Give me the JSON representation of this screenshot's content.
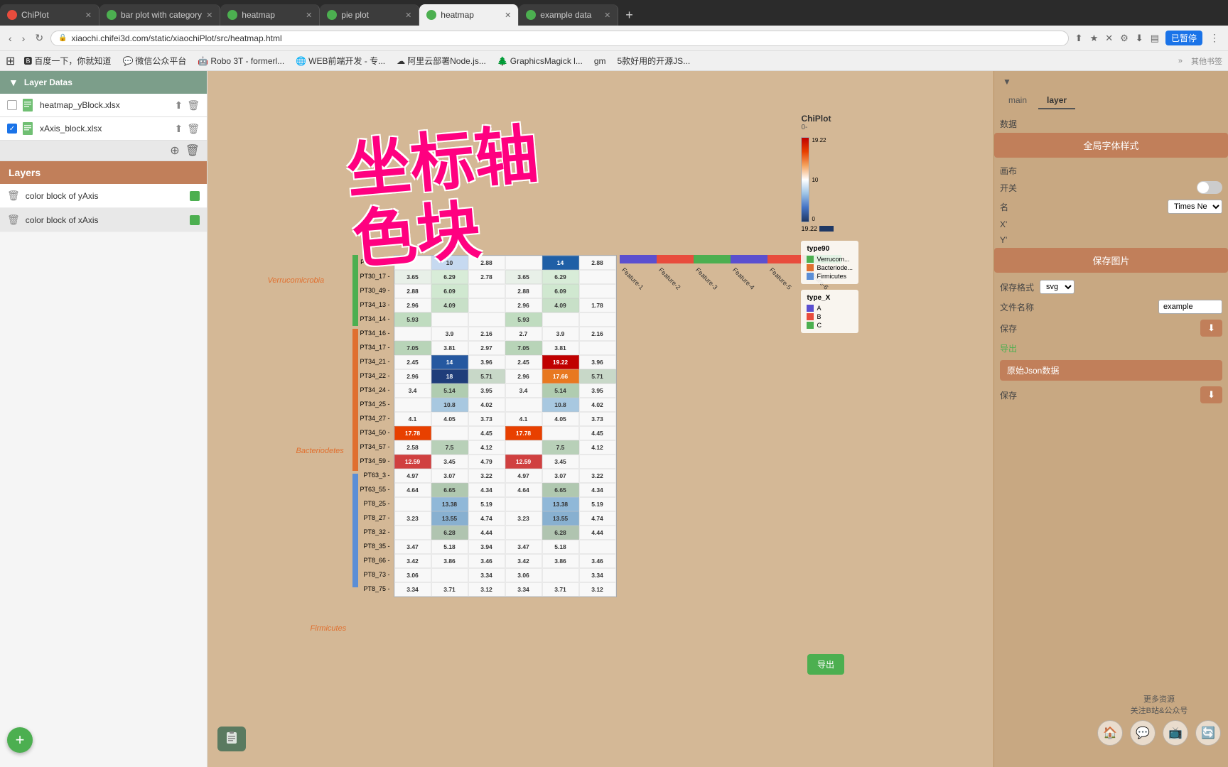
{
  "browser": {
    "tabs": [
      {
        "id": "chiplot",
        "label": "ChiPlot",
        "active": false,
        "icon_color": "#e84c3d"
      },
      {
        "id": "bar-plot",
        "label": "bar plot with category",
        "active": false,
        "icon_color": "#4CAF50"
      },
      {
        "id": "heatmap1",
        "label": "heatmap",
        "active": false,
        "icon_color": "#4CAF50"
      },
      {
        "id": "pie-plot",
        "label": "pie plot",
        "active": false,
        "icon_color": "#4CAF50"
      },
      {
        "id": "heatmap2",
        "label": "heatmap",
        "active": true,
        "icon_color": "#4CAF50"
      },
      {
        "id": "example-data",
        "label": "example data",
        "active": false,
        "icon_color": "#4CAF50"
      }
    ],
    "address": "xiaochi.chifei3d.com/static/xiaochiPlot/src/heatmap.html",
    "user_btn": "已暂停"
  },
  "bookmarks": [
    {
      "label": "百度一下，你就知道"
    },
    {
      "label": "微信公众平台"
    },
    {
      "label": "Robo 3T - formerl..."
    },
    {
      "label": "WEB前端开发 - 专..."
    },
    {
      "label": "阿里云部署Node.js..."
    },
    {
      "label": "GraphicsMagick l..."
    },
    {
      "label": "gm"
    },
    {
      "label": "5款好用的开源JS..."
    },
    {
      "label": "其他书签"
    }
  ],
  "left_panel": {
    "layer_datas_title": "Layer Datas",
    "files": [
      {
        "name": "heatmap_yBlock.xlsx",
        "checked": false
      },
      {
        "name": "xAxis_block.xlsx",
        "checked": true
      }
    ],
    "layers_title": "Layers",
    "layers": [
      {
        "name": "color block of yAxis",
        "color": "#4CAF50",
        "selected": false
      },
      {
        "name": "color block of xAxis",
        "color": "#4CAF50",
        "selected": true
      }
    ],
    "add_btn": "+"
  },
  "right_panel": {
    "tabs": [
      "main",
      "layer"
    ],
    "active_tab": "layer",
    "sections": {
      "data_label": "数据",
      "global_font_btn": "全局字体样式",
      "canvas_label": "画布",
      "toggle_label": "开关",
      "name_label": "名",
      "name_font": "Times Ne",
      "save_img_btn": "保存图片",
      "save_format_label": "保存格式",
      "save_format": "svg",
      "file_name_label": "文件名称",
      "file_name_value": "example",
      "save_label": "保存",
      "export_label": "导出",
      "raw_json_label": "原始Json数据",
      "raw_json_save": "保存"
    },
    "more_resources": {
      "text1": "更多资源",
      "text2": "关注B站&公众号"
    }
  },
  "heatmap": {
    "brand": "ChiPlot",
    "brand_sub": "0-",
    "y_labels": [
      "PT30_11",
      "PT30_17",
      "PT30_49",
      "PT34_13",
      "PT34_14",
      "PT34_16",
      "PT34_17",
      "PT34_21",
      "PT34_22",
      "PT34_24",
      "PT34_25",
      "PT34_27",
      "PT34_50",
      "PT34_57",
      "PT34_59",
      "PT63_3",
      "PT63_55",
      "PT8_25",
      "PT8_27",
      "PT8_32",
      "PT8_35",
      "PT8_66",
      "PT8_73",
      "PT8_75"
    ],
    "x_labels": [
      "Feature-1",
      "Feature-2",
      "Feature-3",
      "Feature-4",
      "Feature-5",
      "Feature-6"
    ],
    "group_labels": [
      {
        "label": "Verrucomicrobia",
        "y_pos": "top"
      },
      {
        "label": "Bacteriodetes",
        "y_pos": "middle"
      },
      {
        "label": "Firmicutes",
        "y_pos": "bottom"
      }
    ],
    "legend_type90": {
      "title": "type90",
      "items": [
        {
          "color": "#4CAF50",
          "label": "Verrucom..."
        },
        {
          "color": "#e07030",
          "label": "Bacteriode..."
        },
        {
          "color": "#5b8ed6",
          "label": "Firmicutes"
        }
      ]
    },
    "legend_typeX": {
      "title": "type_X",
      "items": [
        {
          "color": "#5b4fcf",
          "label": "A"
        },
        {
          "color": "#e84c3d",
          "label": "B"
        },
        {
          "color": "#4CAF50",
          "label": "C"
        }
      ]
    },
    "scale_max": "19.22",
    "scale_label": "19.22 —"
  },
  "watermark": {
    "line1": "坐标轴",
    "line2": "色块"
  },
  "export_btn": "导出",
  "edit_btn_icon": "✏"
}
